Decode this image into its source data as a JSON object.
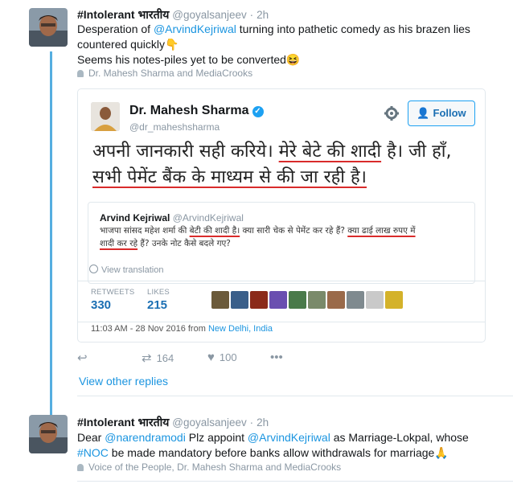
{
  "tweet1": {
    "name": "#Intolerant भारतीय",
    "handle": "@goyalsanjeev",
    "separator": "·",
    "time": "2h",
    "text_part1": "Desperation of ",
    "mention": "@ArvindKejriwal",
    "text_part2": " turning into pathetic comedy as his brazen lies countered quickly",
    "emoji1": "👇",
    "text_line2": "Seems his notes-piles yet to be converted",
    "emoji2": "😆",
    "social_context": "Dr. Mahesh Sharma and MediaCrooks"
  },
  "embedded": {
    "name": "Dr. Mahesh Sharma",
    "verified_glyph": "✓",
    "handle": "@dr_maheshsharma",
    "follow_label": "Follow",
    "follow_icon": "person-plus-icon",
    "hindi_line1_a": "अपनी जानकारी सही करिये। ",
    "hindi_line1_b": "मेरे बेटे की शादी",
    "hindi_line1_c": " है। जी हाँ,",
    "hindi_line2": "सभी पेमेंट बैंक के माध्यम से की जा रही है।",
    "quote": {
      "name": "Arvind Kejriwal",
      "handle": "@ArvindKejriwal",
      "text_a": "भाजपा सांसद महेश शर्मा की ",
      "text_b": "बेटी की शादी है।",
      "text_c": " क्या सारी चेक से पेमेंट कर रहे हैं? ",
      "text_d": "क्या ढाई लाख रुपए में",
      "text_e": "शादी कर रहे",
      "text_f": " हैं? उनके नोट कैसे बदले गए?"
    },
    "translate_label": "View translation",
    "retweets_label": "RETWEETS",
    "retweets_count": "330",
    "likes_label": "LIKES",
    "likes_count": "215",
    "date": "11:03 AM - 28 Nov 2016 from ",
    "location": "New Delhi, India",
    "liker_colors": [
      "#6b5a3a",
      "#3a5f8a",
      "#8b2a1a",
      "#6a4fb0",
      "#4a7a4a",
      "#7a8a6a",
      "#9a6a4a",
      "#7f8a8f",
      "#c9c9c9",
      "#d4b22a"
    ]
  },
  "actions": {
    "reply_icon": "reply-icon",
    "retweet_icon": "retweet-icon",
    "retweet_count": "164",
    "like_icon": "heart-icon",
    "like_count": "100",
    "more_icon": "more-icon"
  },
  "view_other_replies": "View other replies",
  "tweet2": {
    "name": "#Intolerant भारतीय",
    "handle": "@goyalsanjeev",
    "separator": "·",
    "time": "2h",
    "text_a": "Dear ",
    "mention1": "@narendramodi",
    "text_b": " Plz appoint ",
    "mention2": "@ArvindKejriwal",
    "text_c": " as Marriage-Lokpal, whose",
    "hashtag": "#NOC",
    "text_d": " be made mandatory before banks allow withdrawals for marriage",
    "emoji": "🙏",
    "social_context": "Voice of the People, Dr. Mahesh Sharma and MediaCrooks"
  },
  "colors": {
    "link": "#1b95e0",
    "thread_line": "#55aee0",
    "underline": "#d92b2b"
  }
}
